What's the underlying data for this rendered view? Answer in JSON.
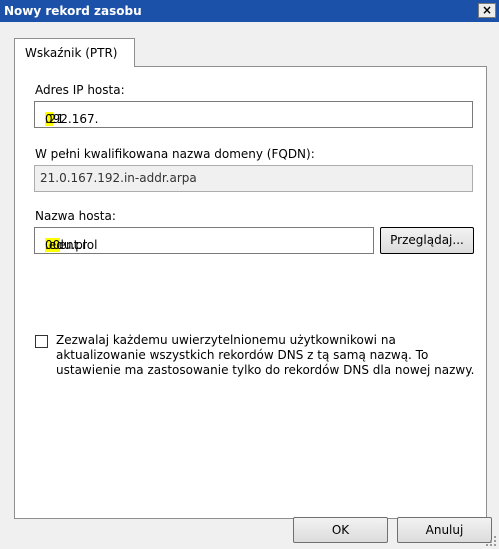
{
  "window": {
    "title": "Nowy rekord zasobu",
    "close_glyph": "×"
  },
  "tabs": [
    {
      "label": "Wskaźnik (PTR)"
    }
  ],
  "fields": {
    "ip_label": "Adres IP hosta:",
    "ip_value_parts": [
      "192.167.",
      "0",
      ".21"
    ],
    "fqdn_label": "W pełni kwalifikowana nazwa domeny (FQDN):",
    "fqdn_value": "21.0.167.192.in-addr.arpa",
    "host_label": "Nazwa hosta:",
    "host_value_parts": [
      "klient.rol",
      "00",
      ".edu.pl"
    ],
    "browse_label": "Przeglądaj..."
  },
  "checkbox": {
    "checked": false,
    "lines": [
      "Zezwalaj każdemu uwierzytelnionemu użytkownikowi na",
      "aktualizowanie wszystkich rekordów DNS z tą samą nazwą. To",
      "ustawienie ma zastosowanie tylko do rekordów DNS dla nowej nazwy."
    ]
  },
  "buttons": {
    "ok": "OK",
    "cancel": "Anuluj"
  },
  "colors": {
    "titlebar": "#1c51aa",
    "highlight": "#ffff00",
    "dialog_bg": "#f0f0f0"
  }
}
